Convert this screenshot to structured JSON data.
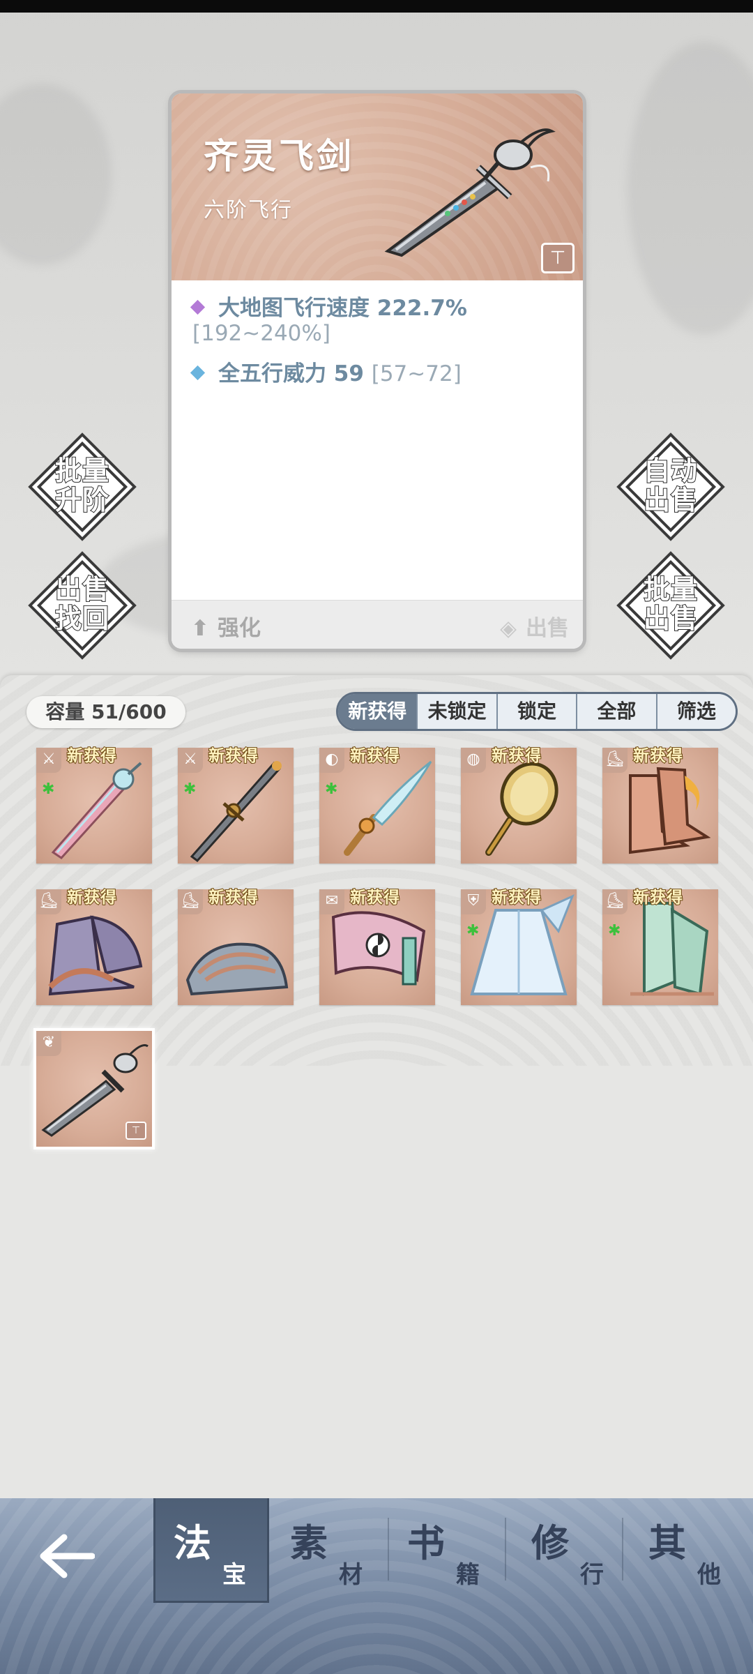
{
  "detail": {
    "name": "齐灵飞剑",
    "grade": "六阶飞行",
    "stats": [
      {
        "label": "大地图飞行速度 222.7%",
        "range": "[192~240%]",
        "color": "#b37ad6"
      },
      {
        "label": "全五行威力 59",
        "range": "[57~72]",
        "color": "#6ab4de"
      }
    ],
    "enhance_label": "强化",
    "sell_label": "出售",
    "lock_icon": "lock-icon"
  },
  "side_buttons": {
    "batch_upgrade": [
      "批量",
      "升阶"
    ],
    "auto_sell": [
      "自动",
      "出售"
    ],
    "sell_recover": [
      "出售",
      "找回"
    ],
    "batch_sell": [
      "批量",
      "出售"
    ]
  },
  "inventory": {
    "capacity_label": "容量 51/600",
    "filters": [
      {
        "label": "新获得",
        "active": true
      },
      {
        "label": "未锁定",
        "active": false
      },
      {
        "label": "锁定",
        "active": false
      },
      {
        "label": "全部",
        "active": false
      },
      {
        "label": "筛选",
        "active": false
      }
    ],
    "new_tag": "新获得",
    "items": [
      {
        "kind": "crystal-sword",
        "type_icon": "sword-type-icon",
        "is_new": true,
        "green_mark": true
      },
      {
        "kind": "long-sword",
        "type_icon": "sword-type-icon",
        "is_new": true,
        "green_mark": true
      },
      {
        "kind": "whisk",
        "type_icon": "spiral-type-icon",
        "is_new": true,
        "green_mark": true
      },
      {
        "kind": "mirror",
        "type_icon": "mirror-type-icon",
        "is_new": true,
        "green_mark": false
      },
      {
        "kind": "flame-boots",
        "type_icon": "boots-type-icon",
        "is_new": true,
        "green_mark": false
      },
      {
        "kind": "dragon-boots",
        "type_icon": "boots-type-icon",
        "is_new": true,
        "green_mark": false
      },
      {
        "kind": "cloud-shoes",
        "type_icon": "boots-type-icon",
        "is_new": true,
        "green_mark": false
      },
      {
        "kind": "scroll",
        "type_icon": "scroll-type-icon",
        "is_new": true,
        "green_mark": false
      },
      {
        "kind": "ice-robe",
        "type_icon": "armor-type-icon",
        "is_new": true,
        "green_mark": true
      },
      {
        "kind": "jade-boots",
        "type_icon": "boots-type-icon",
        "is_new": true,
        "green_mark": true
      },
      {
        "kind": "flying-sword",
        "type_icon": "wing-type-icon",
        "is_new": false,
        "green_mark": false,
        "selected": true,
        "locked": true
      }
    ]
  },
  "bottom_nav": {
    "back_icon": "back-arrow-icon",
    "tabs": [
      {
        "big": "法",
        "small": "宝",
        "active": true
      },
      {
        "big": "素",
        "small": "材",
        "active": false
      },
      {
        "big": "书",
        "small": "籍",
        "active": false
      },
      {
        "big": "修",
        "small": "行",
        "active": false
      },
      {
        "big": "其",
        "small": "他",
        "active": false
      }
    ]
  }
}
